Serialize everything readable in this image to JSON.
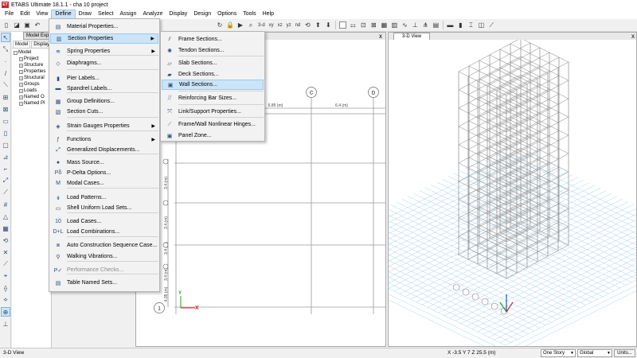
{
  "window": {
    "app_icon": "ET",
    "title": "ETABS Ultimate 18.1.1 - cha 10 project"
  },
  "menubar": {
    "items": [
      "File",
      "Edit",
      "View",
      "Define",
      "Draw",
      "Select",
      "Assign",
      "Analyze",
      "Display",
      "Design",
      "Options",
      "Tools",
      "Help"
    ],
    "active": "Define"
  },
  "toolbar": {
    "label_3d": "3-d",
    "label_xy": "xy",
    "label_xz": "xz",
    "label_yz": "yz",
    "label_nd": "nd"
  },
  "explorer": {
    "title": "Model Explorer",
    "tabs": [
      "Model",
      "Display"
    ],
    "tree_root": "Model",
    "tree_items": [
      "Project",
      "Structure",
      "Properties",
      "Structural",
      "Groups",
      "Loads",
      "Named O",
      "Named Pl"
    ]
  },
  "plan_view": {
    "grid_bubbles_top": [
      "C",
      "D"
    ],
    "grid_bubble_left": "1",
    "dims_top": [
      "6.85 (m)",
      "6.4 (m)"
    ],
    "dims_left": [
      "3.4 (m)",
      "3.4 (m)",
      "3.4 (m)",
      "3.4 (m)",
      "4.05 (m)"
    ],
    "axis_x": "X",
    "axis_y": "Y",
    "close": "x"
  },
  "view3d": {
    "tab": "3-D View",
    "close": "x"
  },
  "define_menu": {
    "items": [
      {
        "label": "Material Properties...",
        "icon": "material-icon",
        "submenu": false
      },
      {
        "label": "Section Properties",
        "icon": "section-properties-icon",
        "submenu": true
      },
      {
        "label": "Spring Properties",
        "icon": "spring-icon",
        "submenu": true
      },
      {
        "label": "Diaphragms...",
        "icon": "diaphragm-icon",
        "submenu": false
      },
      {
        "label": "Pier Labels...",
        "icon": "pier-icon",
        "submenu": false
      },
      {
        "label": "Spandrel Labels...",
        "icon": "spandrel-icon",
        "submenu": false
      },
      {
        "label": "Group Definitions...",
        "icon": "group-icon",
        "submenu": false
      },
      {
        "label": "Section Cuts...",
        "icon": "section-cut-icon",
        "submenu": false
      },
      {
        "label": "Strain Gauges Properties",
        "icon": "strain-gauge-icon",
        "submenu": true
      },
      {
        "label": "Functions",
        "icon": "functions-icon",
        "submenu": true
      },
      {
        "label": "Generalized Displacements...",
        "icon": "displacement-icon",
        "submenu": false
      },
      {
        "label": "Mass Source...",
        "icon": "mass-icon",
        "submenu": false
      },
      {
        "label": "P-Delta Options...",
        "icon": "pdelta-icon",
        "submenu": false
      },
      {
        "label": "Modal Cases...",
        "icon": "modal-icon",
        "submenu": false
      },
      {
        "label": "Load Patterns...",
        "icon": "load-pattern-icon",
        "submenu": false
      },
      {
        "label": "Shell Uniform Load Sets...",
        "icon": "shell-load-icon",
        "submenu": false
      },
      {
        "label": "Load Cases...",
        "icon": "load-case-icon",
        "submenu": false
      },
      {
        "label": "Load Combinations...",
        "icon": "load-combo-icon",
        "submenu": false
      },
      {
        "label": "Auto Construction Sequence Case...",
        "icon": "construction-icon",
        "submenu": false
      },
      {
        "label": "Walking Vibrations...",
        "icon": "walking-icon",
        "submenu": false
      },
      {
        "label": "Performance Checks...",
        "icon": "performance-icon",
        "submenu": false,
        "disabled": true
      },
      {
        "label": "Table Named Sets...",
        "icon": "table-icon",
        "submenu": false
      }
    ],
    "icon_glyphs": [
      "▤",
      "▥",
      "≋",
      "◇",
      "▮",
      "▬",
      "▦",
      "▧",
      "◈",
      "ƒ",
      "⤢",
      "●",
      "Pδ",
      "M",
      "↡",
      "▭",
      "10",
      "D+L",
      "⧈",
      "⚲",
      "P✓",
      "▤"
    ]
  },
  "section_submenu": {
    "items": [
      {
        "label": "Frame Sections...",
        "icon": "frame-section-icon"
      },
      {
        "label": "Tendon Sections...",
        "icon": "tendon-icon"
      },
      {
        "label": "Slab Sections...",
        "icon": "slab-icon"
      },
      {
        "label": "Deck Sections...",
        "icon": "deck-icon"
      },
      {
        "label": "Wall Sections...",
        "icon": "wall-icon"
      },
      {
        "label": "Reinforcing Bar Sizes...",
        "icon": "rebar-icon"
      },
      {
        "label": "Link/Support Properties...",
        "icon": "link-icon"
      },
      {
        "label": "Frame/Wall Nonlinear Hinges...",
        "icon": "hinge-icon"
      },
      {
        "label": "Panel Zone...",
        "icon": "panel-zone-icon"
      }
    ],
    "icon_glyphs": [
      "⫽",
      "✺",
      "▱",
      "▰",
      "▣",
      "⧸⧸",
      "⤧",
      "⟋",
      "▣"
    ],
    "highlighted": "Wall Sections..."
  },
  "statusbar": {
    "left": "3-D View",
    "coords": "X -3.5  Y 7  Z 25.5 (m)",
    "story": "One Story",
    "coord_system": "Global",
    "units": "Units..."
  },
  "colors": {
    "menu_highlight": "#cce4f7",
    "grid_line": "#999999",
    "plane_grid": "#a8d0ea",
    "axis_x": "#d42020",
    "axis_y": "#20a020",
    "axis_z": "#2050d0"
  }
}
